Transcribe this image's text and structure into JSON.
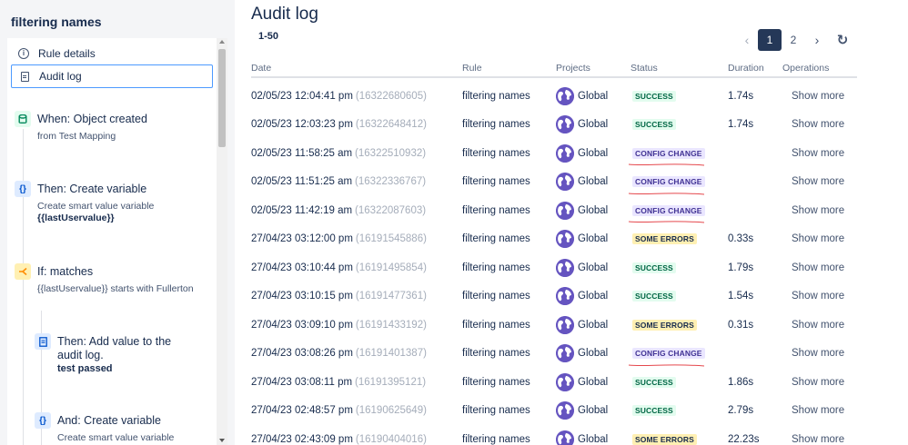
{
  "sidebar": {
    "title": "filtering names",
    "nav": [
      {
        "label": "Rule details",
        "icon": "info-icon"
      },
      {
        "label": "Audit log",
        "icon": "document-icon",
        "active": true
      }
    ],
    "steps": [
      {
        "icon": "database-icon",
        "title": "When: Object created",
        "sub": "from Test Mapping",
        "bold": ""
      },
      {
        "icon": "braces-icon",
        "title": "Then: Create variable",
        "sub": "Create smart value variable",
        "bold": "{{lastUservalue}}"
      },
      {
        "icon": "branch-icon",
        "title": "If: matches",
        "sub": "{{lastUservalue}} starts with Fullerton",
        "bold": ""
      },
      {
        "icon": "document-icon",
        "title": "Then: Add value to the",
        "title2": "audit log.",
        "sub": "",
        "bold": "test passed"
      },
      {
        "icon": "braces-icon",
        "title": "And: Create variable",
        "sub": "Create smart value variable",
        "bold": ""
      }
    ]
  },
  "main": {
    "title": "Audit log",
    "range": "1-50",
    "pagination": {
      "pages": [
        "1",
        "2"
      ],
      "current": "1",
      "prev": "‹",
      "next": "›",
      "refresh": "↻"
    },
    "columns": {
      "date": "Date",
      "rule": "Rule",
      "projects": "Projects",
      "status": "Status",
      "duration": "Duration",
      "operations": "Operations"
    },
    "rows": [
      {
        "date": "02/05/23 12:04:41 pm",
        "id": "(16322680605)",
        "rule": "filtering names",
        "project": "Global",
        "status": "SUCCESS",
        "kind": "success",
        "duration": "1.74s",
        "op": "Show more",
        "mark": false
      },
      {
        "date": "02/05/23 12:03:23 pm",
        "id": "(16322648412)",
        "rule": "filtering names",
        "project": "Global",
        "status": "SUCCESS",
        "kind": "success",
        "duration": "1.74s",
        "op": "Show more",
        "mark": false
      },
      {
        "date": "02/05/23 11:58:25 am",
        "id": "(16322510932)",
        "rule": "filtering names",
        "project": "Global",
        "status": "CONFIG CHANGE",
        "kind": "config",
        "duration": "",
        "op": "Show more",
        "mark": true
      },
      {
        "date": "02/05/23 11:51:25 am",
        "id": "(16322336767)",
        "rule": "filtering names",
        "project": "Global",
        "status": "CONFIG CHANGE",
        "kind": "config",
        "duration": "",
        "op": "Show more",
        "mark": true
      },
      {
        "date": "02/05/23 11:42:19 am",
        "id": "(16322087603)",
        "rule": "filtering names",
        "project": "Global",
        "status": "CONFIG CHANGE",
        "kind": "config",
        "duration": "",
        "op": "Show more",
        "mark": true
      },
      {
        "date": "27/04/23 03:12:00 pm",
        "id": "(16191545886)",
        "rule": "filtering names",
        "project": "Global",
        "status": "SOME ERRORS",
        "kind": "errors",
        "duration": "0.33s",
        "op": "Show more",
        "mark": false
      },
      {
        "date": "27/04/23 03:10:44 pm",
        "id": "(16191495854)",
        "rule": "filtering names",
        "project": "Global",
        "status": "SUCCESS",
        "kind": "success",
        "duration": "1.79s",
        "op": "Show more",
        "mark": false
      },
      {
        "date": "27/04/23 03:10:15 pm",
        "id": "(16191477361)",
        "rule": "filtering names",
        "project": "Global",
        "status": "SUCCESS",
        "kind": "success",
        "duration": "1.54s",
        "op": "Show more",
        "mark": false
      },
      {
        "date": "27/04/23 03:09:10 pm",
        "id": "(16191433192)",
        "rule": "filtering names",
        "project": "Global",
        "status": "SOME ERRORS",
        "kind": "errors",
        "duration": "0.31s",
        "op": "Show more",
        "mark": false
      },
      {
        "date": "27/04/23 03:08:26 pm",
        "id": "(16191401387)",
        "rule": "filtering names",
        "project": "Global",
        "status": "CONFIG CHANGE",
        "kind": "config",
        "duration": "",
        "op": "Show more",
        "mark": true
      },
      {
        "date": "27/04/23 03:08:11 pm",
        "id": "(16191395121)",
        "rule": "filtering names",
        "project": "Global",
        "status": "SUCCESS",
        "kind": "success",
        "duration": "1.86s",
        "op": "Show more",
        "mark": false
      },
      {
        "date": "27/04/23 02:48:57 pm",
        "id": "(16190625649)",
        "rule": "filtering names",
        "project": "Global",
        "status": "SUCCESS",
        "kind": "success",
        "duration": "2.79s",
        "op": "Show more",
        "mark": false
      },
      {
        "date": "27/04/23 02:43:09 pm",
        "id": "(16190404016)",
        "rule": "filtering names",
        "project": "Global",
        "status": "SOME ERRORS",
        "kind": "errors",
        "duration": "22.23s",
        "op": "Show more",
        "mark": false
      }
    ]
  },
  "colors": {
    "accent": "#4c9aff",
    "currentPage": "#253858",
    "globe": "#6554c0",
    "annotation": "#e5484d"
  }
}
